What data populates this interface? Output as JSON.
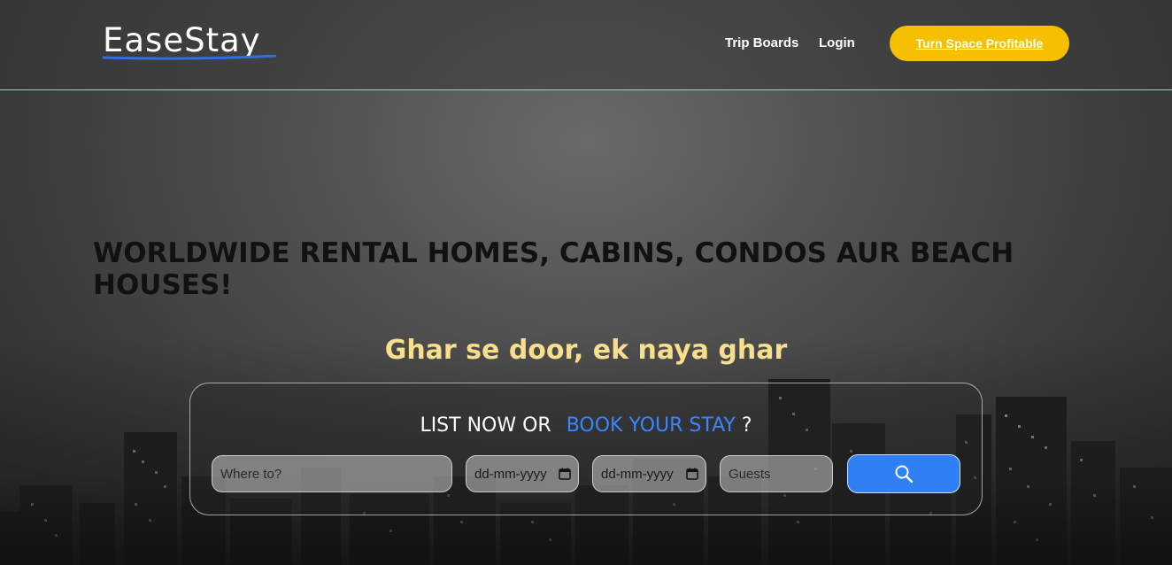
{
  "header": {
    "logo": "EaseStay",
    "nav": {
      "trip_boards": "Trip Boards",
      "login": "Login"
    },
    "cta_label": "Turn Space Profitable"
  },
  "hero": {
    "headline": "WORLDWIDE RENTAL HOMES, CABINS, CONDOS AUR BEACH HOUSES!",
    "tagline": "Ghar se door, ek naya ghar"
  },
  "search": {
    "title_plain": "LIST NOW OR",
    "title_accent": "BOOK YOUR STAY",
    "title_suffix": "?",
    "where_placeholder": "Where to?",
    "checkin_value": "dd-mm-yyyy",
    "checkout_value": "dd-mm-yyyy",
    "guests_placeholder": "Guests",
    "icons": {
      "calendar": "calendar-icon",
      "search": "search-icon"
    }
  },
  "colors": {
    "accent_yellow": "#f5c000",
    "accent_blue": "#2f7ff5",
    "tagline": "#f9de8c",
    "divider": "#e6c24a"
  }
}
